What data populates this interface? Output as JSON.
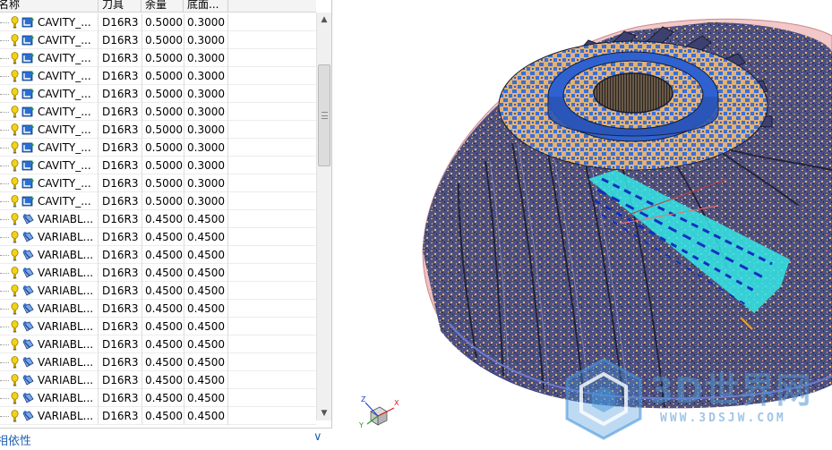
{
  "navigator": {
    "columns": {
      "name": "名称",
      "tool": "刀具",
      "stock": "余量",
      "floor": "底面..."
    },
    "rows": [
      {
        "name": "CAVITY_...",
        "tool": "D16R3",
        "stock": "0.5000",
        "floor": "0.3000",
        "type": "cavity"
      },
      {
        "name": "CAVITY_...",
        "tool": "D16R3",
        "stock": "0.5000",
        "floor": "0.3000",
        "type": "cavity"
      },
      {
        "name": "CAVITY_...",
        "tool": "D16R3",
        "stock": "0.5000",
        "floor": "0.3000",
        "type": "cavity"
      },
      {
        "name": "CAVITY_...",
        "tool": "D16R3",
        "stock": "0.5000",
        "floor": "0.3000",
        "type": "cavity"
      },
      {
        "name": "CAVITY_...",
        "tool": "D16R3",
        "stock": "0.5000",
        "floor": "0.3000",
        "type": "cavity"
      },
      {
        "name": "CAVITY_...",
        "tool": "D16R3",
        "stock": "0.5000",
        "floor": "0.3000",
        "type": "cavity"
      },
      {
        "name": "CAVITY_...",
        "tool": "D16R3",
        "stock": "0.5000",
        "floor": "0.3000",
        "type": "cavity"
      },
      {
        "name": "CAVITY_...",
        "tool": "D16R3",
        "stock": "0.5000",
        "floor": "0.3000",
        "type": "cavity"
      },
      {
        "name": "CAVITY_...",
        "tool": "D16R3",
        "stock": "0.5000",
        "floor": "0.3000",
        "type": "cavity"
      },
      {
        "name": "CAVITY_...",
        "tool": "D16R3",
        "stock": "0.5000",
        "floor": "0.3000",
        "type": "cavity"
      },
      {
        "name": "CAVITY_...",
        "tool": "D16R3",
        "stock": "0.5000",
        "floor": "0.3000",
        "type": "cavity"
      },
      {
        "name": "VARIABL...",
        "tool": "D16R3",
        "stock": "0.4500",
        "floor": "0.4500",
        "type": "variable"
      },
      {
        "name": "VARIABL...",
        "tool": "D16R3",
        "stock": "0.4500",
        "floor": "0.4500",
        "type": "variable"
      },
      {
        "name": "VARIABL...",
        "tool": "D16R3",
        "stock": "0.4500",
        "floor": "0.4500",
        "type": "variable"
      },
      {
        "name": "VARIABL...",
        "tool": "D16R3",
        "stock": "0.4500",
        "floor": "0.4500",
        "type": "variable"
      },
      {
        "name": "VARIABL...",
        "tool": "D16R3",
        "stock": "0.4500",
        "floor": "0.4500",
        "type": "variable"
      },
      {
        "name": "VARIABL...",
        "tool": "D16R3",
        "stock": "0.4500",
        "floor": "0.4500",
        "type": "variable"
      },
      {
        "name": "VARIABL...",
        "tool": "D16R3",
        "stock": "0.4500",
        "floor": "0.4500",
        "type": "variable"
      },
      {
        "name": "VARIABL...",
        "tool": "D16R3",
        "stock": "0.4500",
        "floor": "0.4500",
        "type": "variable"
      },
      {
        "name": "VARIABL...",
        "tool": "D16R3",
        "stock": "0.4500",
        "floor": "0.4500",
        "type": "variable"
      },
      {
        "name": "VARIABL...",
        "tool": "D16R3",
        "stock": "0.4500",
        "floor": "0.4500",
        "type": "variable"
      },
      {
        "name": "VARIABL...",
        "tool": "D16R3",
        "stock": "0.4500",
        "floor": "0.4500",
        "type": "variable"
      },
      {
        "name": "VARIABL...",
        "tool": "D16R3",
        "stock": "0.4500",
        "floor": "0.4500",
        "type": "variable"
      }
    ],
    "dependency_label": "相依性"
  },
  "viewport": {
    "triad": {
      "x": "X",
      "y": "Y",
      "z": "Z"
    },
    "watermark": {
      "main": "3D世界网",
      "sub": "WWW.3DSJW.COM"
    }
  },
  "colors": {
    "header_bg": "#f4f4f4",
    "link_blue": "#2060b0",
    "model_body": "#4a4e7a",
    "model_tan": "#e0b27a",
    "model_blue": "#3a6fd6",
    "toolpath_cyan": "#35e6e6",
    "stock_pink": "#f2c8c8"
  }
}
